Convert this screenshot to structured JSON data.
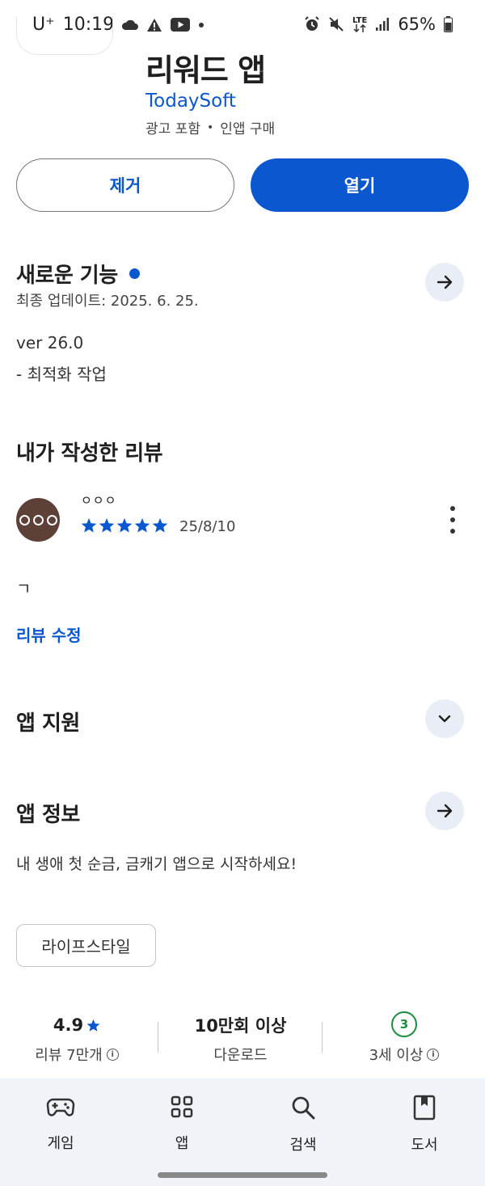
{
  "status_bar": {
    "carrier": "U⁺",
    "time": "10:19",
    "network": "LTE",
    "battery": "65%"
  },
  "app": {
    "title": "리워드 앱",
    "developer": "TodaySoft",
    "meta_ads": "광고 포함",
    "meta_sep": "•",
    "meta_iap": "인앱 구매"
  },
  "actions": {
    "remove_label": "제거",
    "open_label": "열기"
  },
  "whats_new": {
    "title": "새로운 기능",
    "updated": "최종 업데이트: 2025. 6. 25.",
    "version": "ver 26.0",
    "notes": "- 최적화 작업"
  },
  "my_review": {
    "title": "내가 작성한 리뷰",
    "reviewer": "ㅇㅇㅇ",
    "rating": 5,
    "date": "25/8/10",
    "body": "ㄱ",
    "edit_label": "리뷰 수정"
  },
  "app_support": {
    "title": "앱 지원"
  },
  "app_info": {
    "title": "앱 정보",
    "description": "내 생애 첫 순금, 금캐기 앱으로 시작하세요!",
    "category": "라이프스타일"
  },
  "stats": {
    "rating": "4.9",
    "reviews": "리뷰 7만개",
    "downloads": "10만회 이상",
    "downloads_label": "다운로드",
    "age_badge": "3",
    "age_label": "3세 이상"
  },
  "bottom_nav": {
    "items": [
      {
        "label": "게임",
        "icon": "gamepad-icon"
      },
      {
        "label": "앱",
        "icon": "apps-grid-icon"
      },
      {
        "label": "검색",
        "icon": "search-icon"
      },
      {
        "label": "도서",
        "icon": "book-icon"
      }
    ]
  },
  "colors": {
    "accent": "#0b57d0",
    "age_green": "#1e8e3e",
    "avatar": "#5d4037",
    "nav_bg": "#f0f4f9"
  }
}
